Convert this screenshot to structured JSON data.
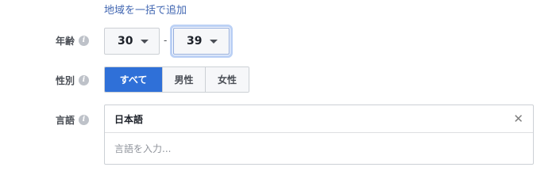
{
  "bulk_add_link": "地域を一括で追加",
  "age": {
    "label": "年齢",
    "min_value": "30",
    "separator": "-",
    "max_value": "39"
  },
  "gender": {
    "label": "性別",
    "options": [
      "すべて",
      "男性",
      "女性"
    ],
    "selected": "すべて"
  },
  "language": {
    "label": "言語",
    "selected_tag": "日本語",
    "input_placeholder": "言語を入力..."
  },
  "colors": {
    "accent": "#2f70d8",
    "link": "#4267b2",
    "focus_ring": "#bcd1f5"
  },
  "icons": {
    "info": "info-icon",
    "dropdown": "caret-down-icon",
    "remove": "close-icon"
  }
}
